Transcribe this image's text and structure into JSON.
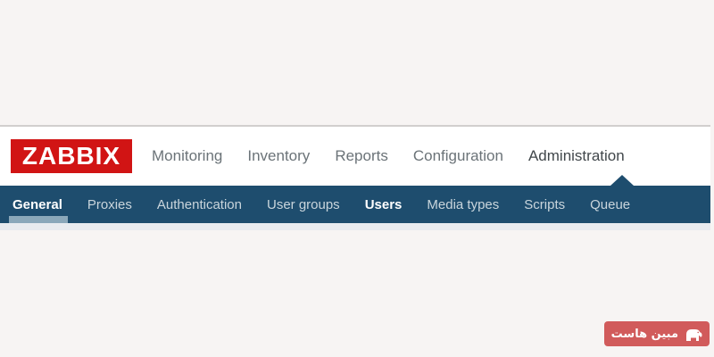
{
  "page": {
    "background_color": "#f7f4f3"
  },
  "header": {
    "logo_text": "ZABBIX",
    "logo_bg_color": "#d11414",
    "menu_items": [
      {
        "label": "Monitoring",
        "active": false
      },
      {
        "label": "Inventory",
        "active": false
      },
      {
        "label": "Reports",
        "active": false
      },
      {
        "label": "Configuration",
        "active": false
      },
      {
        "label": "Administration",
        "active": true
      }
    ]
  },
  "subnav": {
    "bg_color": "#1e4d6e",
    "selected_underline_color": "#8ba8ba",
    "items": [
      {
        "label": "General",
        "selected": true,
        "bold": true
      },
      {
        "label": "Proxies",
        "selected": false,
        "bold": false
      },
      {
        "label": "Authentication",
        "selected": false,
        "bold": false
      },
      {
        "label": "User groups",
        "selected": false,
        "bold": false
      },
      {
        "label": "Users",
        "selected": false,
        "bold": true
      },
      {
        "label": "Media types",
        "selected": false,
        "bold": false
      },
      {
        "label": "Scripts",
        "selected": false,
        "bold": false
      },
      {
        "label": "Queue",
        "selected": false,
        "bold": false
      }
    ]
  },
  "watermark": {
    "text": "مبین هاست",
    "bg_color": "#d15b5b",
    "icon": "elephant-icon"
  }
}
